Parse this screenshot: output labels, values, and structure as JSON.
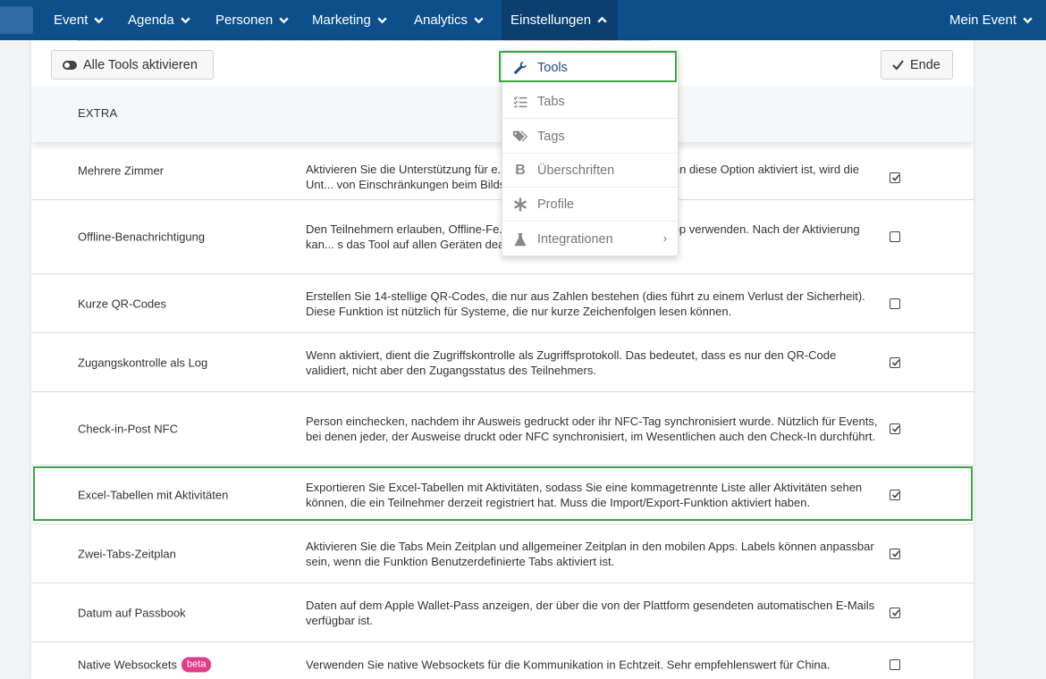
{
  "nav": {
    "items": [
      {
        "label": "Event"
      },
      {
        "label": "Agenda"
      },
      {
        "label": "Personen"
      },
      {
        "label": "Marketing"
      },
      {
        "label": "Analytics"
      },
      {
        "label": "Einstellungen",
        "active": true
      }
    ],
    "right_label": "Mein Event"
  },
  "toolbar": {
    "activate_all_label": "Alle Tools aktivieren",
    "done_label": "Ende"
  },
  "section": {
    "title": "EXTRA"
  },
  "rows": [
    {
      "name": "Mehrere Zimmer",
      "description": "Aktivieren Sie die Unterstützung für e... Unterkünften gehostet wird. Wenn diese Option aktiviert ist, wird die Unt... von Einschränkungen beim Bildschirmspeicherplatz deaktiviert.",
      "checked": true
    },
    {
      "name": "Offline-Benachrichtigung",
      "description": "Den Teilnehmern erlauben, Offline-Fe... alten, während sie die mobile App verwenden. Nach der Aktivierung kan... s das Tool auf allen Geräten deaktiviert ist!",
      "checked": false
    },
    {
      "name": "Kurze QR-Codes",
      "description": "Erstellen Sie 14-stellige QR-Codes, die nur aus Zahlen bestehen (dies führt zu einem Verlust der Sicherheit). Diese Funktion ist nützlich für Systeme, die nur kurze Zeichenfolgen lesen können.",
      "checked": false
    },
    {
      "name": "Zugangskontrolle als Log",
      "description": "Wenn aktiviert, dient die Zugriffskontrolle als Zugriffsprotokoll. Das bedeutet, dass es nur den QR-Code validiert, nicht aber den Zugangsstatus des Teilnehmers.",
      "checked": true
    },
    {
      "name": "Check-in-Post NFC",
      "description": "Person einchecken, nachdem ihr Ausweis gedruckt oder ihr NFC-Tag synchronisiert wurde. Nützlich für Events, bei denen jeder, der Ausweise druckt oder NFC synchronisiert, im Wesentlichen auch den Check-In durchführt.",
      "checked": true
    },
    {
      "name": "Excel-Tabellen mit Aktivitäten",
      "description": "Exportieren Sie Excel-Tabellen mit Aktivitäten, sodass Sie eine kommagetrennte Liste aller Aktivitäten sehen können, die ein Teilnehmer derzeit registriert hat. Muss die Import/Export-Funktion aktiviert haben.",
      "checked": true
    },
    {
      "name": "Zwei-Tabs-Zeitplan",
      "description": "Aktivieren Sie die Tabs Mein Zeitplan und allgemeiner Zeitplan in den mobilen Apps. Labels können anpassbar sein, wenn die Funktion Benutzerdefinierte Tabs aktiviert ist.",
      "checked": true
    },
    {
      "name": "Datum auf Passbook",
      "description": "Daten auf dem Apple Wallet-Pass anzeigen, der über die von der Plattform gesendeten automatischen E-Mails verfügbar ist.",
      "checked": true
    },
    {
      "name": "Native Websockets",
      "badge": "beta",
      "description": "Verwenden Sie native Websockets für die Kommunikation in Echtzeit. Sehr empfehlenswert für China.",
      "checked": false
    }
  ],
  "dropdown": {
    "items": [
      {
        "label": "Tools",
        "icon": "wrench-icon",
        "active": true
      },
      {
        "label": "Tabs",
        "icon": "list-check-icon"
      },
      {
        "label": "Tags",
        "icon": "tags-icon"
      },
      {
        "label": "Überschriften",
        "icon": "bold-icon"
      },
      {
        "label": "Profile",
        "icon": "asterisk-icon"
      },
      {
        "label": "Integrationen",
        "icon": "flask-icon",
        "has_submenu": true
      }
    ]
  },
  "colors": {
    "nav_bg": "#0d4f8b",
    "highlight": "#3aa646",
    "beta_badge": "#e23d8a",
    "active_menu_text": "#1b4f86"
  }
}
